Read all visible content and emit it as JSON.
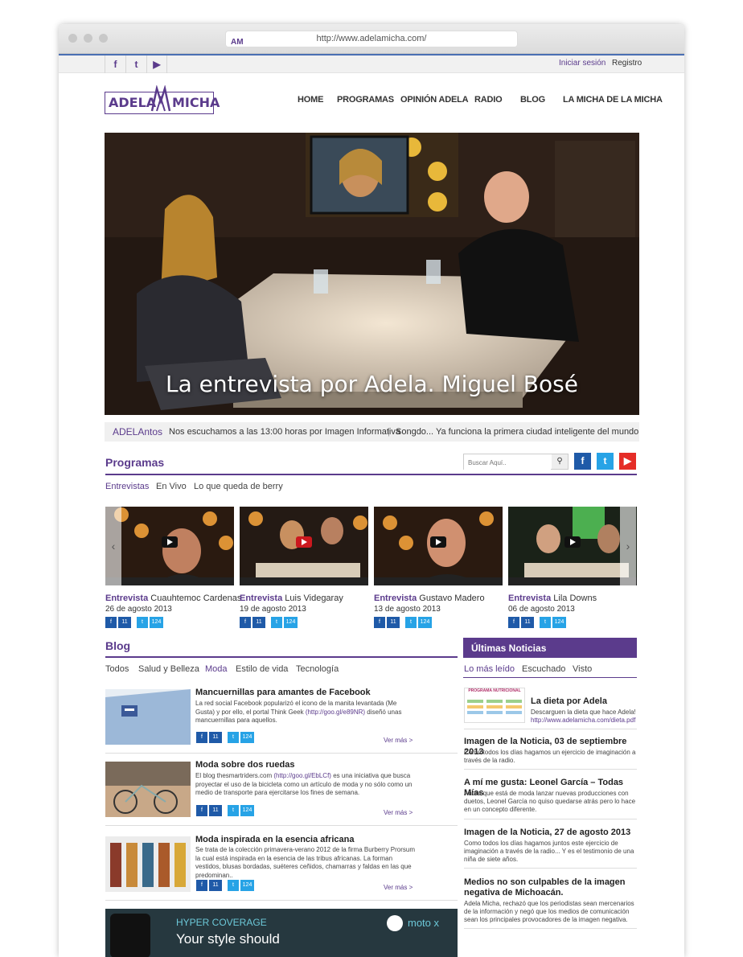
{
  "browser": {
    "url": "http://www.adelamicha.com/"
  },
  "topbar": {
    "social": [
      "f",
      "t",
      "▶"
    ],
    "login": "Iniciar sesión",
    "register": "Registro"
  },
  "logo": {
    "left": "ADELA",
    "right": "MICHA"
  },
  "nav": [
    "HOME",
    "PROGRAMAS",
    "OPINIÓN ADELA",
    "RADIO",
    "BLOG",
    "LA MICHA DE LA MICHA"
  ],
  "hero": {
    "caption": "La entrevista por Adela. Miguel Bosé"
  },
  "ticker": {
    "label": "ADELAntos",
    "item1": "Nos escuchamos a las 13:00 horas por Imagen Informativa",
    "separator": "|",
    "item2": "Songdo... Ya funciona la primera ciudad inteligente del mundo"
  },
  "programas": {
    "title": "Programas",
    "search_placeholder": "Buscar Aquí..",
    "tabs": [
      "Entrevistas",
      "En Vivo",
      "Lo que queda de berry"
    ],
    "videos": [
      {
        "kind": "Entrevista",
        "name": "Cuauhtemoc Cardenas",
        "date": "26 de agosto 2013",
        "fb": "11",
        "tw": "124"
      },
      {
        "kind": "Entrevista",
        "name": "Luis Videgaray",
        "date": "19 de agosto 2013",
        "fb": "11",
        "tw": "124"
      },
      {
        "kind": "Entrevista",
        "name": "Gustavo Madero",
        "date": "13 de agosto 2013",
        "fb": "11",
        "tw": "124"
      },
      {
        "kind": "Entrevista",
        "name": "Lila Downs",
        "date": "06 de agosto 2013",
        "fb": "11",
        "tw": "124"
      }
    ]
  },
  "blog": {
    "title": "Blog",
    "tabs": [
      "Todos",
      "Salud y Belleza",
      "Moda",
      "Estilo de vida",
      "Tecnología"
    ],
    "posts": [
      {
        "title": "Mancuernillas para amantes de Facebook",
        "text_a": "La red social Facebook popularizó el icono de la manita levantada (Me Gusta) y por ello, el portal Think Geek ",
        "link": "(http://goo.gl/e89NR)",
        "text_b": " diseñó unas mancuernillas para aquellos.",
        "fb": "11",
        "tw": "124",
        "more": "Ver más  >"
      },
      {
        "title": "Moda sobre dos ruedas",
        "text_a": "El blog thesmartriders.com ",
        "link": "(http://goo.gl/EbLCf)",
        "text_b": " es una iniciativa que busca proyectar el uso de la bicicleta como un artículo de moda y no sólo como un medio de transporte para ejercitarse los fines de semana.",
        "fb": "11",
        "tw": "124",
        "more": "Ver más  >"
      },
      {
        "title": "Moda inspirada en la esencia africana",
        "text_a": "Se trata de la colección primavera-verano 2012 de la firma Burberry Prorsum la cual está inspirada en la esencia de las tribus africanas. La forman vestidos, blusas bordadas, suéteres ceñidos, chamarras y faldas en las que predominan..",
        "link": "",
        "text_b": "",
        "fb": "11",
        "tw": "124",
        "more": "Ver más  >"
      }
    ],
    "ad": {
      "line1": "HYPER COVERAGE",
      "line2": "Your style should",
      "brand": "moto x"
    }
  },
  "noticias": {
    "title": "Últimas Noticias",
    "tabs": [
      "Lo más leído",
      "Escuchado",
      "Visto"
    ],
    "featured": {
      "title": "La dieta por Adela",
      "text": "Descarguen la dieta que hace Adela!",
      "link": "http://www.adelamicha.com/dieta.pdf",
      "thumb_label": "PROGRAMA NUTRICIONAL"
    },
    "items": [
      {
        "title": "Imagen de la Noticia, 03 de septiembre 2013",
        "text": "Como todos los días hagamos un ejercicio de imaginación a través de la radio."
      },
      {
        "title": "A mí me gusta: Leonel García – Todas Mías",
        "text": "Ahora que está de moda lanzar nuevas producciones con duetos, Leonel García no quiso quedarse atrás pero lo hace en un concepto diferente."
      },
      {
        "title": "Imagen de la Noticia, 27 de agosto 2013",
        "text": "Como todos los días hagamos juntos este ejercicio de imaginación a través de la radio... Y es el testimonio de una niña de siete años."
      },
      {
        "title": "Medios no son culpables de la imagen negativa de Michoacán.",
        "text": "Adela Micha, rechazó que los periodistas sean mercenarios de la información y negó que los medios de comunicación sean los principales provocadores de la imagen negativa."
      }
    ]
  },
  "colors": {
    "brand": "#5b3b8c",
    "facebook": "#1f5aa8",
    "twitter": "#27a3e6",
    "youtube": "#e52d27"
  }
}
